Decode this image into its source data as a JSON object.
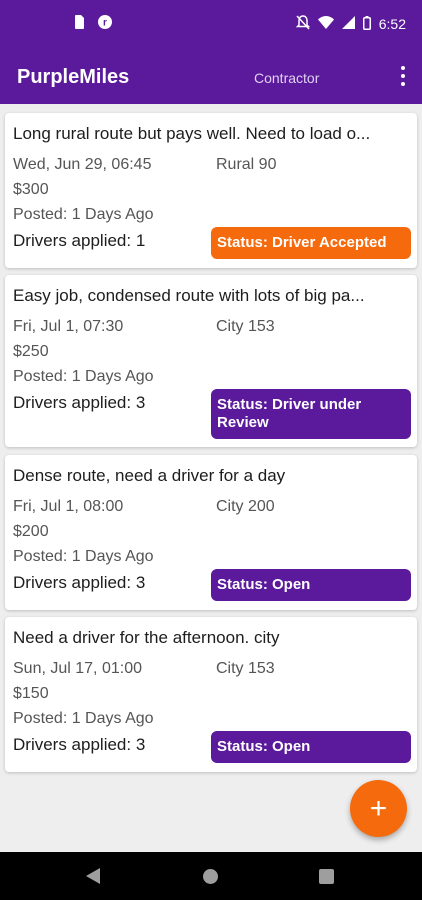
{
  "status_bar": {
    "time": "6:52",
    "left_icons": [
      "sim-card-icon",
      "app-notification-icon"
    ],
    "right_icons": [
      "notifications-off-icon",
      "wifi-icon",
      "signal-icon",
      "battery-icon"
    ]
  },
  "app_bar": {
    "title": "PurpleMiles",
    "role": "Contractor",
    "menu_icon": "overflow-menu-icon"
  },
  "colors": {
    "primary": "#5b1a9b",
    "accent": "#f56a0c",
    "status_accepted": "#f56a0c",
    "status_default": "#5b1a9b"
  },
  "jobs": [
    {
      "title": "Long rural route but pays well. Need to load o...",
      "date": "Wed, Jun 29, 06:45",
      "route": "Rural 90",
      "price": "$300",
      "posted": "Posted: 1 Days Ago",
      "applied": "Drivers applied: 1",
      "status": "Status: Driver Accepted"
    },
    {
      "title": "Easy job, condensed route with lots of big pa...",
      "date": "Fri, Jul 1, 07:30",
      "route": "City 153",
      "price": "$250",
      "posted": "Posted: 1 Days Ago",
      "applied": "Drivers applied: 3",
      "status": "Status: Driver under Review"
    },
    {
      "title": "Dense route, need a driver for a day",
      "date": "Fri, Jul 1, 08:00",
      "route": "City 200",
      "price": "$200",
      "posted": "Posted: 1 Days Ago",
      "applied": "Drivers applied: 3",
      "status": "Status: Open"
    },
    {
      "title": "Need a driver for the afternoon. city",
      "date": "Sun, Jul 17, 01:00",
      "route": "City 153",
      "price": "$150",
      "posted": "Posted: 1 Days Ago",
      "applied": "Drivers applied: 3",
      "status": "Status: Open"
    }
  ],
  "fab": {
    "label": "+",
    "icon": "add-icon"
  },
  "nav_bar": {
    "icons": [
      "back-icon",
      "home-icon",
      "recents-icon"
    ]
  }
}
